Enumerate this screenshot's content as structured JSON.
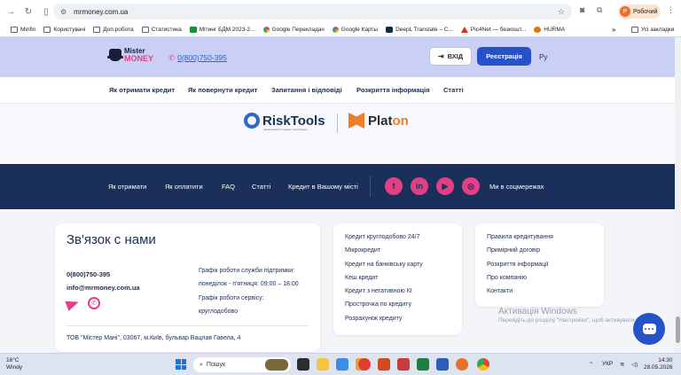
{
  "browser": {
    "url": "mrmoney.com.ua",
    "profile_label": "Робочий",
    "profile_initial": "Р",
    "bookmarks": [
      "Minfin",
      "Користувачі",
      "Доп.робота",
      "Статистика",
      "Мітинг БДМ 2023-2...",
      "Google Перекладач",
      "Google Карты",
      "DeepL Translate – С...",
      "Pic4Net — безкошт...",
      "HURMA"
    ],
    "all_bookmarks_label": "Усі закладки"
  },
  "header": {
    "logo_line1": "Mister",
    "logo_line2": "MONEY",
    "phone": "0(800)750-395",
    "login_label": "ВХІД",
    "register_label": "Реєстрація",
    "lang": "Ру"
  },
  "nav": {
    "items": [
      "Як отримати кредит",
      "Як повернути кредит",
      "Запитання і відповіді",
      "Розкриття інформація",
      "Статті"
    ]
  },
  "partners": {
    "risktools_name": "RiskTools",
    "risktools_sub": "ефективний інструмент для бізнесу",
    "platon_name": "Plat",
    "platon_on": "on"
  },
  "footer_bar": {
    "links": [
      "Як отримати",
      "Як оплатити",
      "FAQ",
      "Статті",
      "Кредит в Вашому місті"
    ],
    "social_icons": [
      "facebook-icon",
      "linkedin-icon",
      "youtube-icon",
      "instagram-icon"
    ],
    "social_label": "Ми в соцмережах"
  },
  "contacts": {
    "title": "Зв'язок с нами",
    "phone": "0(800)750-395",
    "email": "info@mrmoney.com.ua",
    "support_hours_title": "Графік роботи служби підтримки:",
    "support_hours": "понеділок - п'ятниця: 09:00 – 18:00",
    "service_hours_title": "Графік роботи сервісу:",
    "service_hours": "круглодобово",
    "address": "ТОВ \"Містер Мані\", 03067, м.Київ, бульвар Вацлав Гавела, 4"
  },
  "links_col2": [
    "Кредит круглодобово 24/7",
    "Мікрокредит",
    "Кредит на банківську карту",
    "Кеш кредит",
    "Кредит з негативною КІ",
    "Прострочка по кредиту",
    "Розрахунок кредиту"
  ],
  "links_col3": [
    "Правила кредитування",
    "Примірний договір",
    "Розкриття інформації",
    "Про компанію",
    "Контакти"
  ],
  "watermark": {
    "title": "Активація Windows",
    "text": "Перейдіть до розділу \"Настройки\", щоб активувати Windows."
  },
  "taskbar": {
    "temp": "16°C",
    "weather": "Windy",
    "search_label": "Пошук",
    "lang": "УКР",
    "time": "14:30",
    "date": "28.05.2026"
  }
}
